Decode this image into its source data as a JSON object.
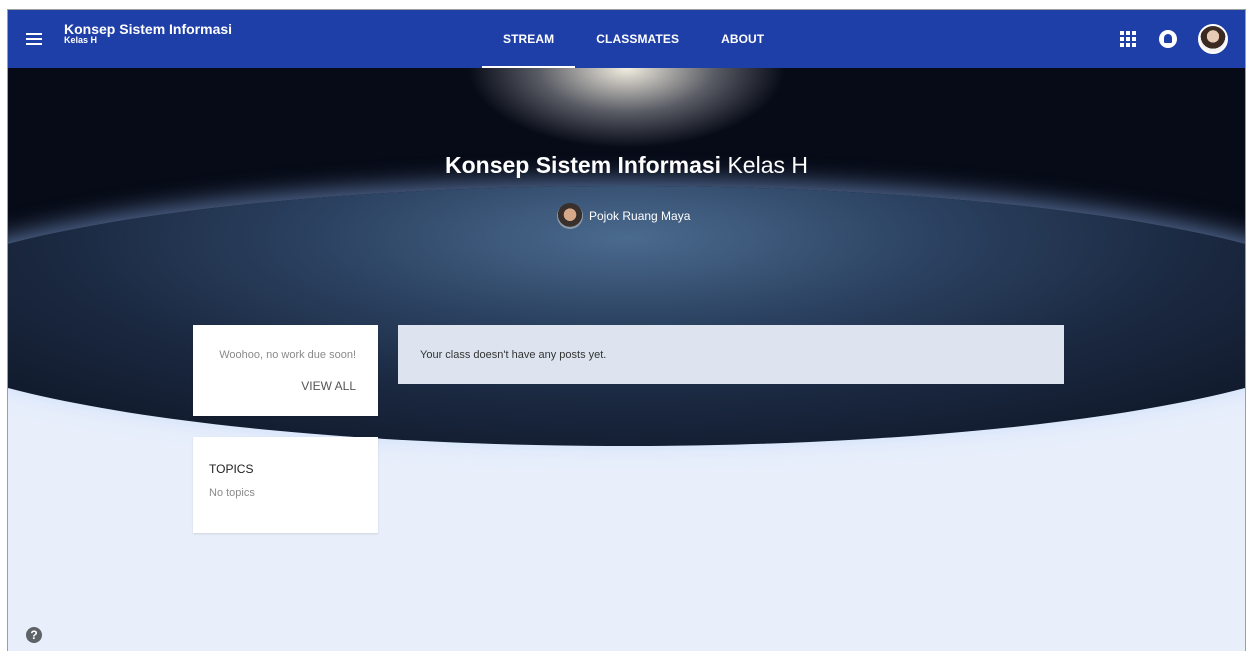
{
  "header": {
    "class_name": "Konsep Sistem Informasi",
    "section": "Kelas H",
    "tabs": [
      {
        "label": "STREAM",
        "active": true
      },
      {
        "label": "CLASSMATES",
        "active": false
      },
      {
        "label": "ABOUT",
        "active": false
      }
    ],
    "menu_icon": "hamburger-menu-icon",
    "apps_icon": "apps-grid-icon",
    "notifications_icon": "notification-bell-icon",
    "avatar_icon": "user-avatar"
  },
  "banner": {
    "title_bold": "Konsep Sistem Informasi",
    "title_light": "Kelas H",
    "teacher_name": "Pojok Ruang Maya"
  },
  "upcoming": {
    "message": "Woohoo, no work due soon!",
    "view_all": "VIEW ALL"
  },
  "topics": {
    "heading": "TOPICS",
    "empty": "No topics"
  },
  "stream": {
    "empty_message": "Your class doesn't have any posts yet."
  },
  "help": {
    "icon": "help-icon",
    "glyph": "?"
  },
  "colors": {
    "header_bg": "#1f3fa8",
    "page_bg": "#e8effb",
    "stream_panel_bg": "#dde4ef"
  }
}
